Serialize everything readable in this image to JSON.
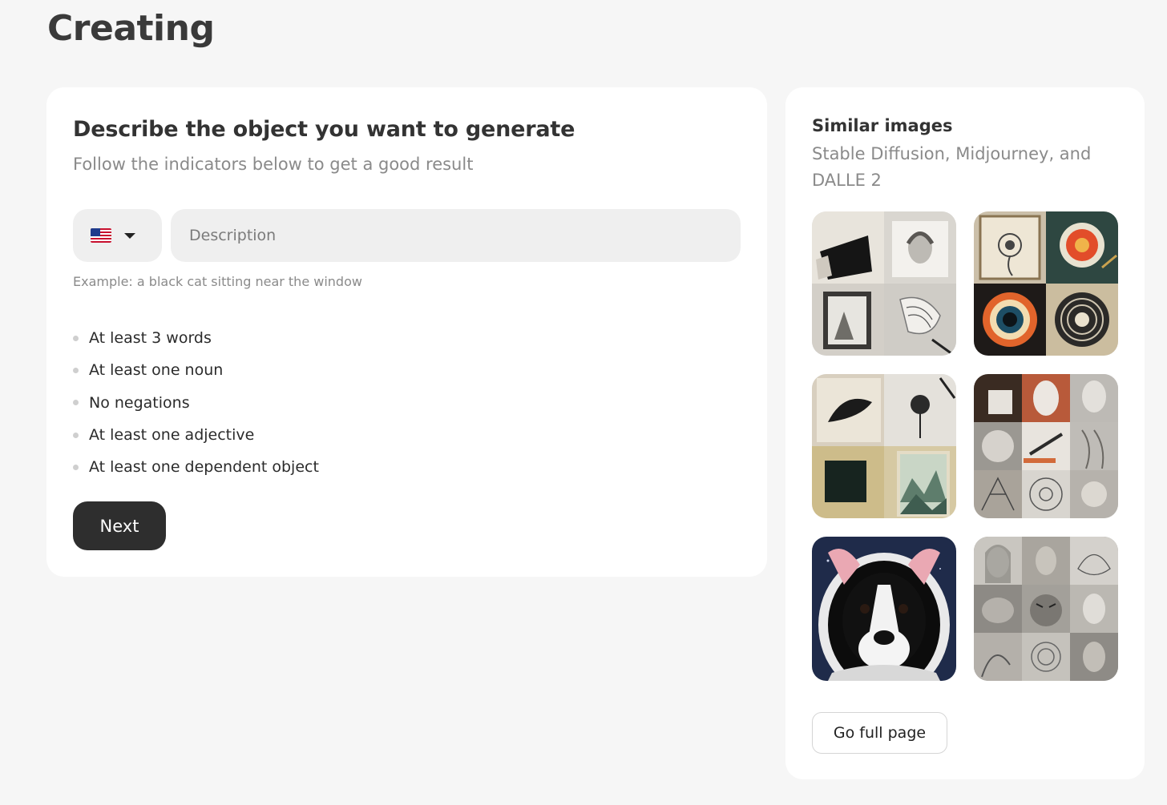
{
  "page": {
    "title": "Creating"
  },
  "form": {
    "heading": "Describe the object you want to generate",
    "subheading": "Follow the indicators below to get a good result",
    "language_flag": "us-flag-icon",
    "description_placeholder": "Description",
    "description_value": "",
    "example": "Example: a black cat sitting near the window",
    "rules": [
      "At least 3 words",
      "At least one noun",
      "No negations",
      "At least one adjective",
      "At least one dependent object"
    ],
    "next_label": "Next"
  },
  "similar": {
    "title": "Similar images",
    "subtitle": "Stable Diffusion, Midjourney, and DALLE 2",
    "thumbnails": [
      "sketches-collage-image",
      "circular-art-collage-image",
      "minimal-art-collage-image",
      "pencil-drawings-collage-image",
      "astronaut-dog-image",
      "portrait-sketches-grid-image"
    ],
    "full_page_label": "Go full page"
  },
  "colors": {
    "background": "#f6f6f6",
    "card": "#ffffff",
    "button_dark": "#2e2e2e",
    "input_bg": "#efefef"
  }
}
